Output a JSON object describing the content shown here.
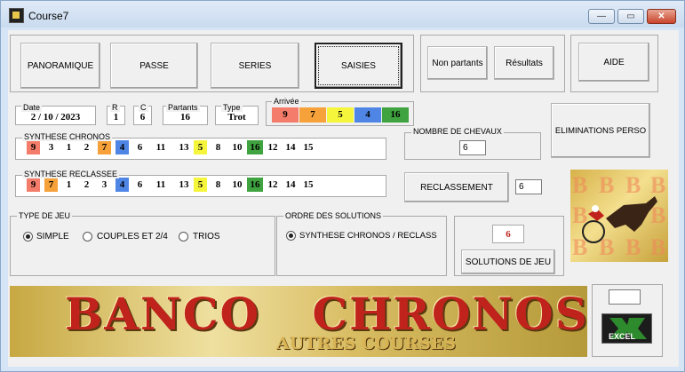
{
  "window": {
    "title": "Course7",
    "minimize": "—",
    "maximize": "▭",
    "close": "✕"
  },
  "nav": {
    "panoramique": "PANORAMIQUE",
    "passe": "PASSE",
    "series": "SERIES",
    "saisies": "SAISIES",
    "non_partants": "Non partants",
    "resultats": "Résultats",
    "aide": "AIDE"
  },
  "race": {
    "date_label": "Date",
    "date": "2 / 10 / 2023",
    "r_label": "R",
    "r": "1",
    "c_label": "C",
    "c": "6",
    "partants_label": "Partants",
    "partants": "16",
    "type_label": "Type",
    "type": "Trot",
    "arrivee_label": "Arrivée",
    "arrivee": [
      {
        "n": "9",
        "color": "#f47c6a"
      },
      {
        "n": "7",
        "color": "#f6a13a"
      },
      {
        "n": "5",
        "color": "#f5f53c"
      },
      {
        "n": "4",
        "color": "#4f86e6"
      },
      {
        "n": "16",
        "color": "#3fa33f"
      }
    ]
  },
  "synthese_chronos": {
    "label": "SYNTHESE CHRONOS",
    "items": [
      {
        "n": "9",
        "color": "#f47c6a"
      },
      {
        "n": "3",
        "color": ""
      },
      {
        "n": "1",
        "color": ""
      },
      {
        "n": "2",
        "color": ""
      },
      {
        "n": "7",
        "color": "#f6a13a"
      },
      {
        "n": "4",
        "color": "#4f86e6"
      },
      {
        "n": "6",
        "color": ""
      },
      {
        "n": "11",
        "color": ""
      },
      {
        "n": "13",
        "color": ""
      },
      {
        "n": "5",
        "color": "#f5f53c"
      },
      {
        "n": "8",
        "color": ""
      },
      {
        "n": "10",
        "color": ""
      },
      {
        "n": "16",
        "color": "#3fa33f"
      },
      {
        "n": "12",
        "color": ""
      },
      {
        "n": "14",
        "color": ""
      },
      {
        "n": "15",
        "color": ""
      }
    ]
  },
  "synthese_reclassee": {
    "label": "SYNTHESE RECLASSEE",
    "items": [
      {
        "n": "9",
        "color": "#f47c6a"
      },
      {
        "n": "7",
        "color": "#f6a13a"
      },
      {
        "n": "1",
        "color": ""
      },
      {
        "n": "2",
        "color": ""
      },
      {
        "n": "3",
        "color": ""
      },
      {
        "n": "4",
        "color": "#4f86e6"
      },
      {
        "n": "6",
        "color": ""
      },
      {
        "n": "11",
        "color": ""
      },
      {
        "n": "13",
        "color": ""
      },
      {
        "n": "5",
        "color": "#f5f53c"
      },
      {
        "n": "8",
        "color": ""
      },
      {
        "n": "10",
        "color": ""
      },
      {
        "n": "16",
        "color": "#3fa33f"
      },
      {
        "n": "12",
        "color": ""
      },
      {
        "n": "14",
        "color": ""
      },
      {
        "n": "15",
        "color": ""
      }
    ]
  },
  "chevaux": {
    "label": "NOMBRE DE CHEVAUX",
    "value": "6"
  },
  "eliminations": "ELIMINATIONS  PERSO",
  "reclassement": {
    "label": "RECLASSEMENT",
    "value": "6"
  },
  "type_jeu": {
    "label": "TYPE DE JEU",
    "simple": "SIMPLE",
    "couples": "COUPLES  ET  2/4",
    "trios": "TRIOS",
    "selected": "simple"
  },
  "ordre": {
    "label": "ORDRE DES SOLUTIONS",
    "option": "SYNTHESE CHRONOS / RECLASS"
  },
  "solutions": {
    "count": "6",
    "button": "SOLUTIONS DE JEU"
  },
  "banner": {
    "title": "BANCO   CHRONOS",
    "subtitle": "AUTRES COURSES"
  },
  "excel": {
    "label": "EXCEL"
  },
  "emblem_letter": "B",
  "colors": {
    "accent_red": "#c0231c",
    "gold": "#c9a640"
  }
}
